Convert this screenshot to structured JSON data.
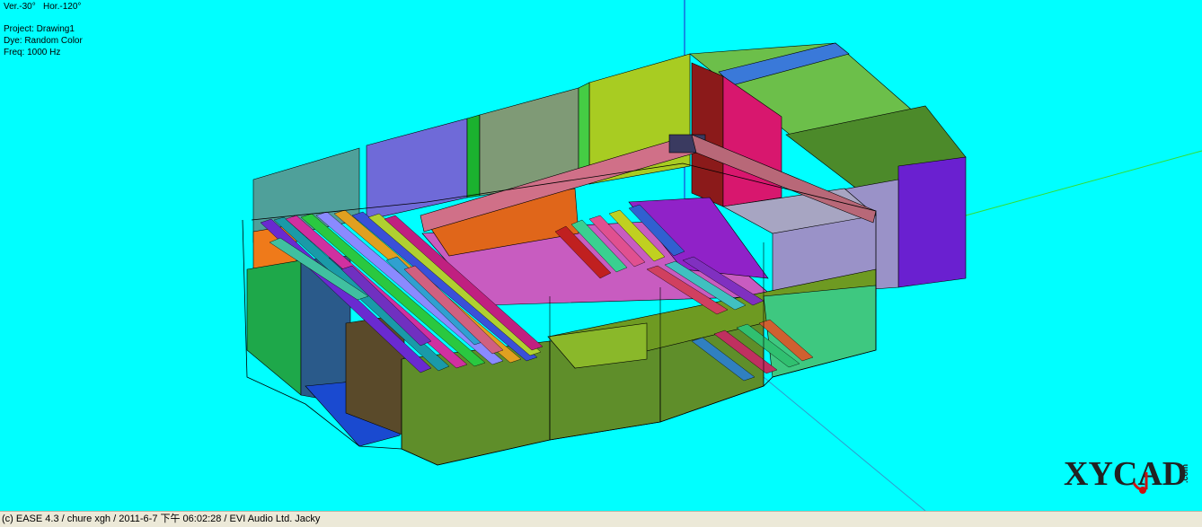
{
  "view": {
    "angles": "Ver.-30°   Hor.-120°",
    "project": "Project: Drawing1",
    "dye": "Dye: Random Color",
    "freq": "Freq: 1000 Hz"
  },
  "status": {
    "text": "(c) EASE 4.3  / chure xgh / 2011-6-7 下午 06:02:28 / EVI Audio Ltd. Jacky"
  },
  "logo": {
    "text": "XYCAD",
    "suffix": ".com"
  },
  "colors": {
    "background": "#00ffff",
    "statusbar": "#ece9d8",
    "logo": "#222222",
    "logo_accent": "#cc1111"
  }
}
